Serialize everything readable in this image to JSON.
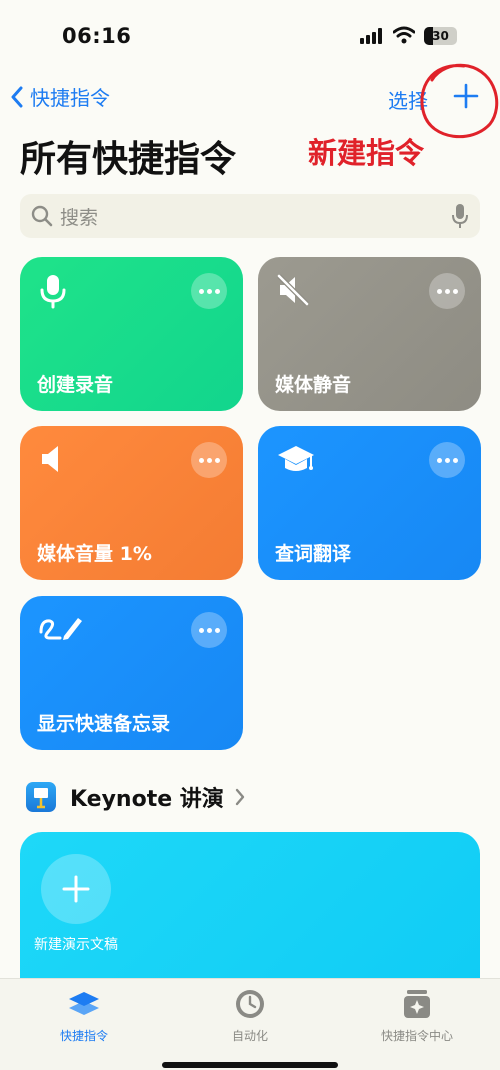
{
  "status": {
    "time": "06:16",
    "battery": "30"
  },
  "nav": {
    "back_label": "快捷指令",
    "select_label": "选择"
  },
  "title": "所有快捷指令",
  "annotation": {
    "text": "新建指令",
    "color": "#e0222a"
  },
  "search": {
    "placeholder": "搜索"
  },
  "tiles": [
    {
      "label": "创建录音",
      "icon": "microphone-icon",
      "color": "#1fe38a"
    },
    {
      "label": "媒体静音",
      "icon": "speaker-muted-icon",
      "color": "#9c9a90"
    },
    {
      "label": "媒体音量 1%",
      "icon": "speaker-icon",
      "color": "#ff8a3d"
    },
    {
      "label": "查词翻译",
      "icon": "graduation-cap-icon",
      "color": "#1c95ff"
    },
    {
      "label": "显示快速备忘录",
      "icon": "scribble-pen-icon",
      "color": "#1c95ff"
    }
  ],
  "section": {
    "title": "Keynote 讲演"
  },
  "keynote_card": {
    "new_label": "新建演示文稿"
  },
  "tabbar": [
    {
      "label": "快捷指令",
      "icon": "layers-icon",
      "active": true
    },
    {
      "label": "自动化",
      "icon": "clock-icon",
      "active": false
    },
    {
      "label": "快捷指令中心",
      "icon": "gallery-sparkle-icon",
      "active": false
    }
  ],
  "colors": {
    "accent": "#1d7cf2",
    "background": "#fbfbf6"
  }
}
